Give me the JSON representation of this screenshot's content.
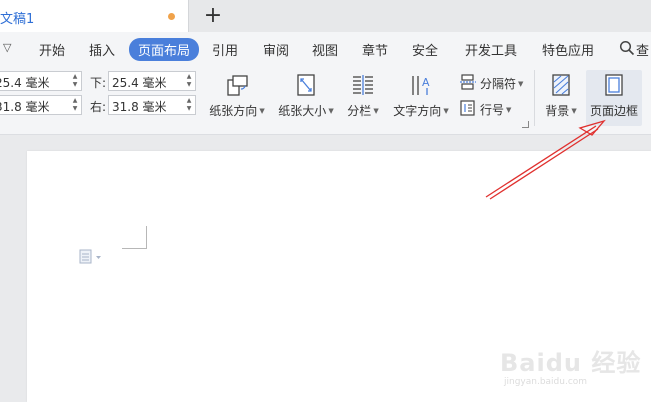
{
  "tabbar": {
    "doc_title": "文稿1",
    "new_tab": "+"
  },
  "menu": {
    "collapse_glyph": "▽",
    "items": [
      {
        "label": "开始"
      },
      {
        "label": "插入"
      },
      {
        "label": "页面布局"
      },
      {
        "label": "引用"
      },
      {
        "label": "审阅"
      },
      {
        "label": "视图"
      },
      {
        "label": "章节"
      },
      {
        "label": "安全"
      },
      {
        "label": "开发工具"
      },
      {
        "label": "特色应用"
      }
    ],
    "active": "页面布局",
    "search_label": "查"
  },
  "margins": {
    "top_value": "25.4 毫米",
    "left_value": "31.8 毫米",
    "bottom_label": "下:",
    "bottom_value": "25.4 毫米",
    "right_label": "右:",
    "right_value": "31.8 毫米"
  },
  "ribbon": {
    "orientation": "纸张方向",
    "size": "纸张大小",
    "columns": "分栏",
    "text_direction": "文字方向",
    "breaks": "分隔符",
    "line_numbers": "行号",
    "background": "背景",
    "page_border": "页面边框"
  },
  "watermark": {
    "brand": "Baidu 经验",
    "url": "jingyan.baidu.com"
  },
  "colors": {
    "accent": "#4a7fdb",
    "annotation": "#e0312f",
    "unsaved": "#f0a24a"
  }
}
